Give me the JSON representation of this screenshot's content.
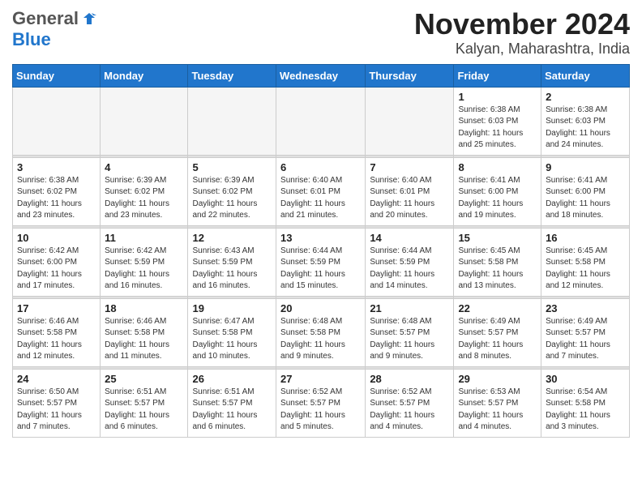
{
  "logo": {
    "general": "General",
    "blue": "Blue"
  },
  "header": {
    "month": "November 2024",
    "location": "Kalyan, Maharashtra, India"
  },
  "weekdays": [
    "Sunday",
    "Monday",
    "Tuesday",
    "Wednesday",
    "Thursday",
    "Friday",
    "Saturday"
  ],
  "weeks": [
    [
      {
        "day": "",
        "info": ""
      },
      {
        "day": "",
        "info": ""
      },
      {
        "day": "",
        "info": ""
      },
      {
        "day": "",
        "info": ""
      },
      {
        "day": "",
        "info": ""
      },
      {
        "day": "1",
        "info": "Sunrise: 6:38 AM\nSunset: 6:03 PM\nDaylight: 11 hours\nand 25 minutes."
      },
      {
        "day": "2",
        "info": "Sunrise: 6:38 AM\nSunset: 6:03 PM\nDaylight: 11 hours\nand 24 minutes."
      }
    ],
    [
      {
        "day": "3",
        "info": "Sunrise: 6:38 AM\nSunset: 6:02 PM\nDaylight: 11 hours\nand 23 minutes."
      },
      {
        "day": "4",
        "info": "Sunrise: 6:39 AM\nSunset: 6:02 PM\nDaylight: 11 hours\nand 23 minutes."
      },
      {
        "day": "5",
        "info": "Sunrise: 6:39 AM\nSunset: 6:02 PM\nDaylight: 11 hours\nand 22 minutes."
      },
      {
        "day": "6",
        "info": "Sunrise: 6:40 AM\nSunset: 6:01 PM\nDaylight: 11 hours\nand 21 minutes."
      },
      {
        "day": "7",
        "info": "Sunrise: 6:40 AM\nSunset: 6:01 PM\nDaylight: 11 hours\nand 20 minutes."
      },
      {
        "day": "8",
        "info": "Sunrise: 6:41 AM\nSunset: 6:00 PM\nDaylight: 11 hours\nand 19 minutes."
      },
      {
        "day": "9",
        "info": "Sunrise: 6:41 AM\nSunset: 6:00 PM\nDaylight: 11 hours\nand 18 minutes."
      }
    ],
    [
      {
        "day": "10",
        "info": "Sunrise: 6:42 AM\nSunset: 6:00 PM\nDaylight: 11 hours\nand 17 minutes."
      },
      {
        "day": "11",
        "info": "Sunrise: 6:42 AM\nSunset: 5:59 PM\nDaylight: 11 hours\nand 16 minutes."
      },
      {
        "day": "12",
        "info": "Sunrise: 6:43 AM\nSunset: 5:59 PM\nDaylight: 11 hours\nand 16 minutes."
      },
      {
        "day": "13",
        "info": "Sunrise: 6:44 AM\nSunset: 5:59 PM\nDaylight: 11 hours\nand 15 minutes."
      },
      {
        "day": "14",
        "info": "Sunrise: 6:44 AM\nSunset: 5:59 PM\nDaylight: 11 hours\nand 14 minutes."
      },
      {
        "day": "15",
        "info": "Sunrise: 6:45 AM\nSunset: 5:58 PM\nDaylight: 11 hours\nand 13 minutes."
      },
      {
        "day": "16",
        "info": "Sunrise: 6:45 AM\nSunset: 5:58 PM\nDaylight: 11 hours\nand 12 minutes."
      }
    ],
    [
      {
        "day": "17",
        "info": "Sunrise: 6:46 AM\nSunset: 5:58 PM\nDaylight: 11 hours\nand 12 minutes."
      },
      {
        "day": "18",
        "info": "Sunrise: 6:46 AM\nSunset: 5:58 PM\nDaylight: 11 hours\nand 11 minutes."
      },
      {
        "day": "19",
        "info": "Sunrise: 6:47 AM\nSunset: 5:58 PM\nDaylight: 11 hours\nand 10 minutes."
      },
      {
        "day": "20",
        "info": "Sunrise: 6:48 AM\nSunset: 5:58 PM\nDaylight: 11 hours\nand 9 minutes."
      },
      {
        "day": "21",
        "info": "Sunrise: 6:48 AM\nSunset: 5:57 PM\nDaylight: 11 hours\nand 9 minutes."
      },
      {
        "day": "22",
        "info": "Sunrise: 6:49 AM\nSunset: 5:57 PM\nDaylight: 11 hours\nand 8 minutes."
      },
      {
        "day": "23",
        "info": "Sunrise: 6:49 AM\nSunset: 5:57 PM\nDaylight: 11 hours\nand 7 minutes."
      }
    ],
    [
      {
        "day": "24",
        "info": "Sunrise: 6:50 AM\nSunset: 5:57 PM\nDaylight: 11 hours\nand 7 minutes."
      },
      {
        "day": "25",
        "info": "Sunrise: 6:51 AM\nSunset: 5:57 PM\nDaylight: 11 hours\nand 6 minutes."
      },
      {
        "day": "26",
        "info": "Sunrise: 6:51 AM\nSunset: 5:57 PM\nDaylight: 11 hours\nand 6 minutes."
      },
      {
        "day": "27",
        "info": "Sunrise: 6:52 AM\nSunset: 5:57 PM\nDaylight: 11 hours\nand 5 minutes."
      },
      {
        "day": "28",
        "info": "Sunrise: 6:52 AM\nSunset: 5:57 PM\nDaylight: 11 hours\nand 4 minutes."
      },
      {
        "day": "29",
        "info": "Sunrise: 6:53 AM\nSunset: 5:57 PM\nDaylight: 11 hours\nand 4 minutes."
      },
      {
        "day": "30",
        "info": "Sunrise: 6:54 AM\nSunset: 5:58 PM\nDaylight: 11 hours\nand 3 minutes."
      }
    ]
  ]
}
